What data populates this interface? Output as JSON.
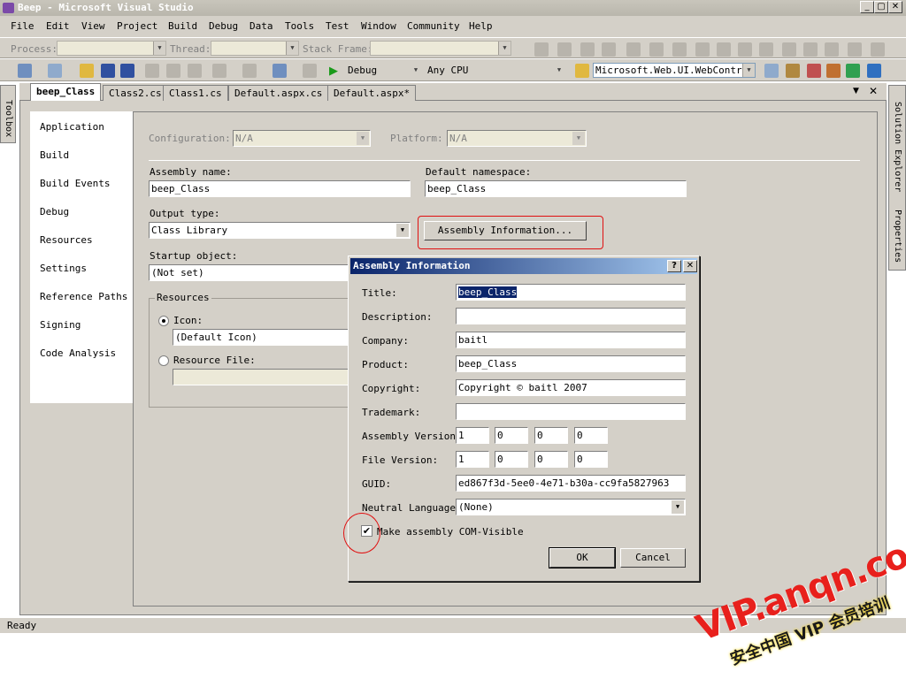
{
  "window": {
    "title": "Beep - Microsoft Visual Studio"
  },
  "menu": [
    "File",
    "Edit",
    "View",
    "Project",
    "Build",
    "Debug",
    "Data",
    "Tools",
    "Test",
    "Window",
    "Community",
    "Help"
  ],
  "debug_toolbar": {
    "process_label": "Process:",
    "thread_label": "Thread:",
    "stack_label": "Stack Frame:"
  },
  "std_toolbar": {
    "config": "Debug",
    "platform": "Any CPU",
    "find": "Microsoft.Web.UI.WebControls"
  },
  "tabs": [
    "beep_Class",
    "Class2.cs",
    "Class1.cs",
    "Default.aspx.cs",
    "Default.aspx*"
  ],
  "side": {
    "toolbox": "Toolbox",
    "solution_explorer": "Solution Explorer",
    "properties": "Properties"
  },
  "nav": [
    "Application",
    "Build",
    "Build Events",
    "Debug",
    "Resources",
    "Settings",
    "Reference Paths",
    "Signing",
    "Code Analysis"
  ],
  "app": {
    "configuration_label": "Configuration:",
    "configuration_value": "N/A",
    "platform_label": "Platform:",
    "platform_value": "N/A",
    "assembly_name_label": "Assembly name:",
    "assembly_name": "beep_Class",
    "default_ns_label": "Default namespace:",
    "default_ns": "beep_Class",
    "output_type_label": "Output type:",
    "output_type": "Class Library",
    "assembly_info_button": "Assembly Information...",
    "startup_label": "Startup object:",
    "startup_value": "(Not set)",
    "resources_group": "Resources",
    "icon_label": "Icon:",
    "icon_value": "(Default Icon)",
    "resource_file_label": "Resource File:"
  },
  "dialog": {
    "title": "Assembly Information",
    "help": "?",
    "close": "✕",
    "title_label": "Title:",
    "title_value": "beep_Class",
    "description_label": "Description:",
    "description_value": "",
    "company_label": "Company:",
    "company_value": "baitl",
    "product_label": "Product:",
    "product_value": "beep_Class",
    "copyright_label": "Copyright:",
    "copyright_value": "Copyright © baitl 2007",
    "trademark_label": "Trademark:",
    "trademark_value": "",
    "assembly_version_label": "Assembly Version:",
    "assembly_version": [
      "1",
      "0",
      "0",
      "0"
    ],
    "file_version_label": "File Version:",
    "file_version": [
      "1",
      "0",
      "0",
      "0"
    ],
    "guid_label": "GUID:",
    "guid_value": "ed867f3d-5ee0-4e71-b30a-cc9fa5827963",
    "neutral_lang_label": "Neutral Language:",
    "neutral_lang_value": "(None)",
    "com_visible_label": "Make assembly COM-Visible",
    "com_visible": true,
    "ok": "OK",
    "cancel": "Cancel"
  },
  "status": "Ready",
  "watermark": {
    "line1": "VIP.anqn.com",
    "line2": "安全中国 VIP 会员培训"
  }
}
